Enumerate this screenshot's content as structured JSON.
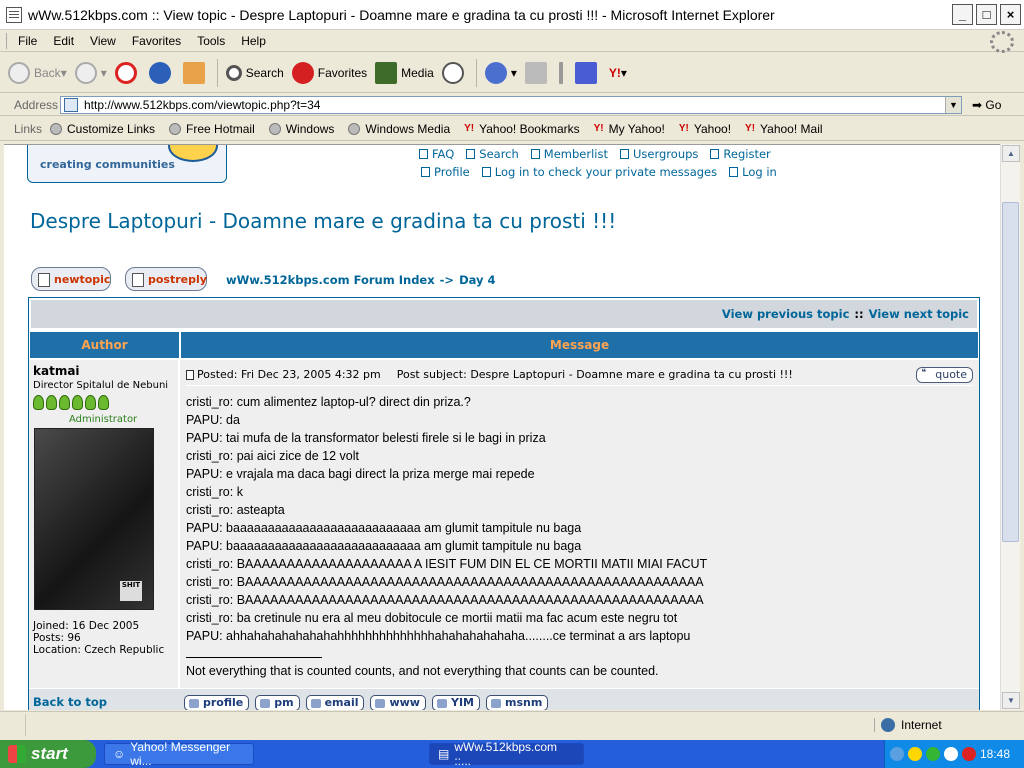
{
  "window": {
    "title": "wWw.512kbps.com :: View topic - Despre Laptopuri - Doamne mare e gradina ta cu prosti !!! - Microsoft Internet Explorer"
  },
  "menu": [
    "File",
    "Edit",
    "View",
    "Favorites",
    "Tools",
    "Help"
  ],
  "toolbar": {
    "back": "Back",
    "search": "Search",
    "favorites": "Favorites",
    "media": "Media"
  },
  "address": {
    "label": "Address",
    "url": "http://www.512kbps.com/viewtopic.php?t=34",
    "go": "Go"
  },
  "links": {
    "label": "Links",
    "items": [
      "Customize Links",
      "Free Hotmail",
      "Windows",
      "Windows Media",
      "Yahoo! Bookmarks",
      "My Yahoo!",
      "Yahoo!",
      "Yahoo! Mail"
    ]
  },
  "page": {
    "logo_text": "creating communities",
    "nav_top": [
      "FAQ",
      "Search",
      "Memberlist",
      "Usergroups",
      "Register"
    ],
    "nav_bottom": [
      "Profile",
      "Log in to check your private messages",
      "Log in"
    ],
    "title": "Despre Laptopuri - Doamne mare e gradina ta cu prosti !!!",
    "buttons": {
      "newtopic": "newtopic",
      "postreply": "postreply"
    },
    "breadcrumb": {
      "index": "wWw.512kbps.com Forum Index",
      "arrow": "->",
      "forum": "Day 4"
    },
    "view_prev": "View previous topic",
    "view_sep": "::",
    "view_next": "View next topic",
    "col_author": "Author",
    "col_message": "Message",
    "post": {
      "author": "katmai",
      "rank": "Director Spitalul de Nebuni",
      "admin": "Administrator",
      "avatar_text": "SHIT",
      "joined": "Joined: 16 Dec 2005",
      "posts": "Posts: 96",
      "location": "Location: Czech Republic",
      "posted": "Posted: Fri Dec 23, 2005 4:32 pm",
      "subject": "Post subject: Despre Laptopuri - Doamne mare e gradina ta cu prosti !!!",
      "quote": "quote",
      "lines": [
        "cristi_ro: cum alimentez laptop-ul? direct din priza.?",
        "PAPU: da",
        "PAPU: tai mufa de la transformator belesti firele si le bagi in priza",
        "cristi_ro: pai aici zice de 12 volt",
        "PAPU: e vrajala ma daca bagi direct la priza merge mai repede",
        "cristi_ro: k",
        "cristi_ro: asteapta",
        "PAPU: baaaaaaaaaaaaaaaaaaaaaaaaaaa am glumit tampitule nu baga",
        "PAPU: baaaaaaaaaaaaaaaaaaaaaaaaaaa am glumit tampitule nu baga",
        "cristi_ro: BAAAAAAAAAAAAAAAAAAAA A IESIT FUM DIN EL CE MORTII MATII MIAI FACUT",
        "cristi_ro: BAAAAAAAAAAAAAAAAAAAAAAAAAAAAAAAAAAAAAAAAAAAAAAAAAAAAAAA",
        "cristi_ro: BAAAAAAAAAAAAAAAAAAAAAAAAAAAAAAAAAAAAAAAAAAAAAAAAAAAAAAA",
        "cristi_ro: ba cretinule nu era al meu dobitocule ce mortii matii ma fac acum este negru tot",
        "PAPU: ahhahahahahahahahhhhhhhhhhhhhhahahahahahaha........ce terminat a ars laptopu"
      ],
      "signature": "Not everything that is counted counts, and not everything that counts can be counted."
    },
    "back_to_top": "Back to top",
    "post_buttons": [
      "profile",
      "pm",
      "email",
      "www",
      "YIM",
      "msnm"
    ]
  },
  "status": {
    "zone": "Internet"
  },
  "taskbar": {
    "start": "start",
    "tasks": [
      "Yahoo! Messenger wi...",
      "wWw.512kbps.com ::..."
    ],
    "clock": "18:48"
  }
}
